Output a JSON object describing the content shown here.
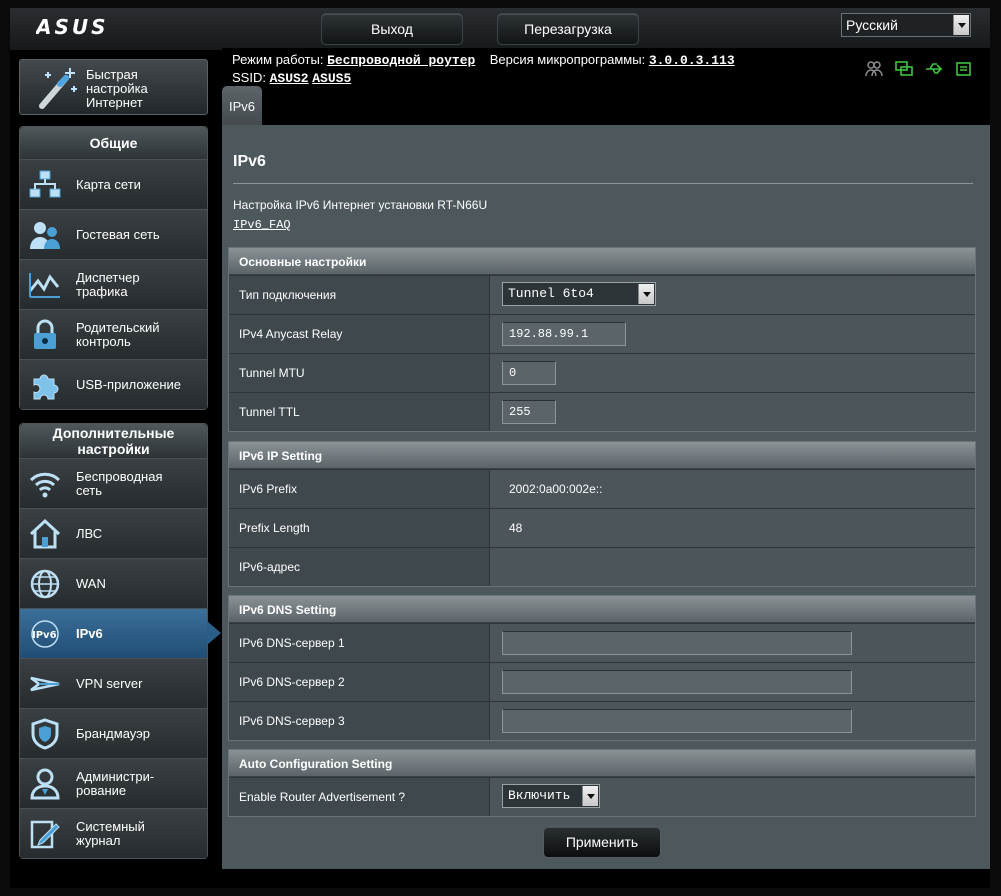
{
  "brand": "ASUS",
  "top_buttons": {
    "logout": "Выход",
    "reboot": "Перезагрузка"
  },
  "language": {
    "selected": "Русский"
  },
  "info": {
    "mode_label": "Режим работы:",
    "mode_value": "Беспроводной роутер",
    "fw_label": "Версия микропрограммы:",
    "fw_value": "3.0.0.3.113",
    "ssid_label": "SSID:",
    "ssid_values": [
      "ASUS2",
      "ASUS5"
    ]
  },
  "status_icons": [
    "clients-icon",
    "network-icon",
    "usb-icon",
    "printer-icon"
  ],
  "quick_setup": {
    "label": "Быстрая настройка Интернет",
    "line1": "Быстрая",
    "line2": "настройка",
    "line3": "Интернет"
  },
  "general": {
    "title": "Общие",
    "items": [
      {
        "label": "Карта сети",
        "icon": "network-map-icon"
      },
      {
        "label": "Гостевая сеть",
        "icon": "guest-network-icon"
      },
      {
        "label": "Диспетчер трафика",
        "icon": "traffic-manager-icon"
      },
      {
        "label": "Родительский контроль",
        "icon": "lock-icon"
      },
      {
        "label": "USB-приложение",
        "icon": "puzzle-icon"
      }
    ]
  },
  "advanced": {
    "title": "Дополнительные настройки",
    "items": [
      {
        "label": "Беспроводная сеть",
        "icon": "wifi-icon"
      },
      {
        "label": "ЛВС",
        "icon": "home-icon"
      },
      {
        "label": "WAN",
        "icon": "globe-icon"
      },
      {
        "label": "IPv6",
        "icon": "ipv6-icon"
      },
      {
        "label": "VPN server",
        "icon": "vpn-icon"
      },
      {
        "label": "Брандмауэр",
        "icon": "firewall-icon"
      },
      {
        "label": "Администри-рование",
        "icon": "admin-icon"
      },
      {
        "label": "Системный журнал",
        "icon": "log-icon"
      }
    ]
  },
  "tab": {
    "label": "IPv6"
  },
  "page": {
    "title": "IPv6",
    "description": "Настройка IPv6 Интернет установки RT-N66U",
    "faq": "IPv6_FAQ"
  },
  "basic": {
    "title": "Основные настройки",
    "conn_type_label": "Тип подключения",
    "conn_type_value": "Tunnel 6to4",
    "anycast_label": "IPv4 Anycast Relay",
    "anycast_value": "192.88.99.1",
    "mtu_label": "Tunnel MTU",
    "mtu_value": "0",
    "ttl_label": "Tunnel TTL",
    "ttl_value": "255"
  },
  "ip_setting": {
    "title": "IPv6 IP Setting",
    "prefix_label": "IPv6 Prefix",
    "prefix_value": "2002:0a00:002e::",
    "plen_label": "Prefix Length",
    "plen_value": "48",
    "addr_label": "IPv6-адрес",
    "addr_value": ""
  },
  "dns": {
    "title": "IPv6 DNS Setting",
    "dns1_label": "IPv6 DNS-сервер 1",
    "dns1_value": "",
    "dns2_label": "IPv6 DNS-сервер 2",
    "dns2_value": "",
    "dns3_label": "IPv6 DNS-сервер 3",
    "dns3_value": ""
  },
  "auto": {
    "title": "Auto Configuration Setting",
    "ra_label": "Enable Router Advertisement ?",
    "ra_value": "Включить"
  },
  "apply_label": "Применить"
}
